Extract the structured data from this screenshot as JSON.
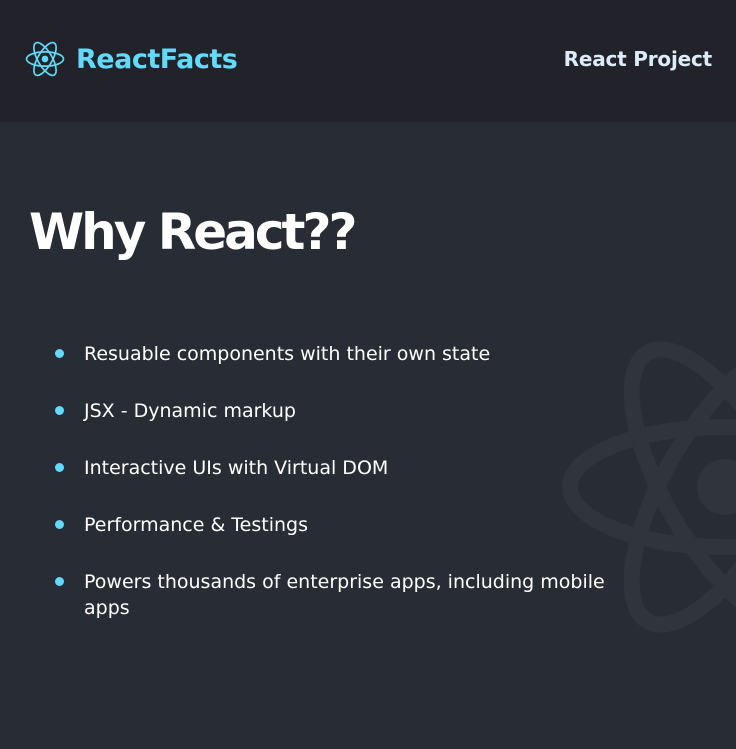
{
  "colors": {
    "navbar_bg": "#21222a",
    "main_bg": "#282d35",
    "brand_accent": "#61dafb",
    "nav_right_text": "#deebf8",
    "text": "#ffffff",
    "bg_logo": "#2f343d"
  },
  "navbar": {
    "logo_icon": "react-atom-icon",
    "brand": "ReactFacts",
    "right_label": "React Project"
  },
  "main": {
    "title": "Why React??",
    "bullet_icon": "bullet-dot-icon",
    "background_icon": "react-atom-icon",
    "facts": [
      {
        "text": "Resuable components with their own state"
      },
      {
        "text": "JSX - Dynamic markup"
      },
      {
        "text": "Interactive UIs with Virtual DOM"
      },
      {
        "text": "Performance & Testings"
      },
      {
        "text": "Powers thousands of enterprise apps, including mobile apps"
      }
    ]
  }
}
